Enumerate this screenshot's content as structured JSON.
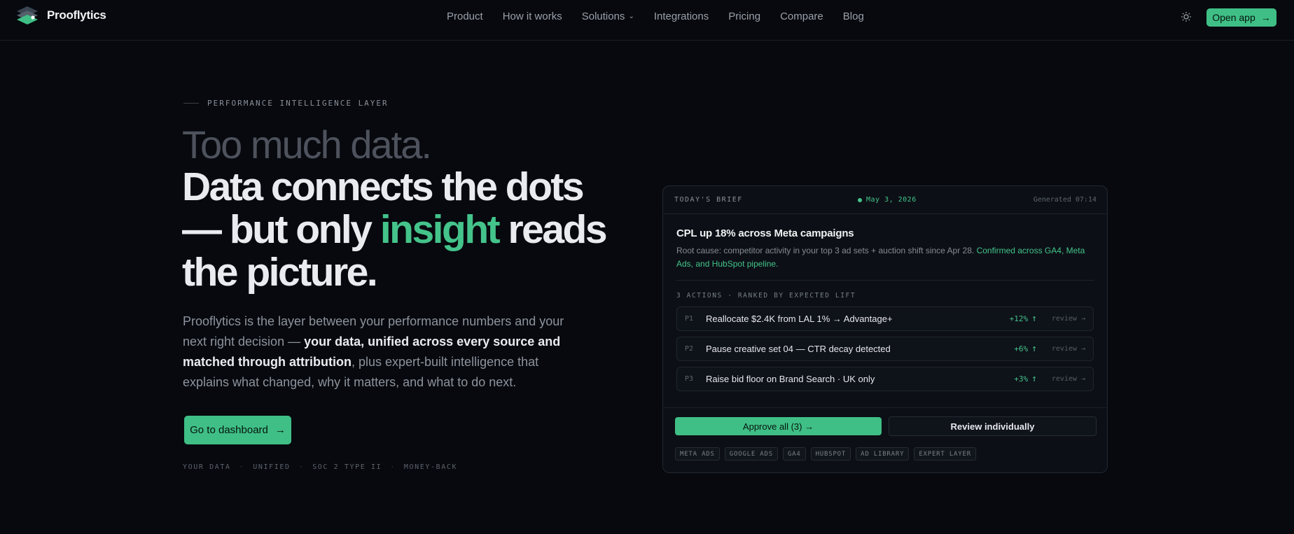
{
  "brand": {
    "name": "Prooflytics"
  },
  "nav": {
    "links": [
      "Product",
      "How it works",
      "Solutions",
      "Integrations",
      "Pricing",
      "Compare",
      "Blog"
    ],
    "open_app": "Open app"
  },
  "hero": {
    "eyebrow": "PERFORMANCE INTELLIGENCE LAYER",
    "headline_muted": "Too much data.",
    "headline_1": "Data connects the dots",
    "headline_2a": "— but only ",
    "headline_accent": "insight",
    "headline_2b": " reads",
    "headline_3": "the picture.",
    "lede_1": "Prooflytics is the layer between your performance numbers and your next right decision — ",
    "lede_bold": "your data, unified across every source and matched through attribution",
    "lede_2": ", plus expert-built intelligence that explains what changed, why it matters, and what to do next.",
    "cta": "Go to dashboard",
    "trust": [
      "YOUR DATA",
      "UNIFIED",
      "SOC 2 TYPE II",
      "MONEY-BACK"
    ]
  },
  "brief": {
    "label": "TODAY'S BRIEF",
    "date": "May 3, 2026",
    "generated": "Generated 07:14",
    "title": "CPL up 18% across Meta campaigns",
    "desc_1": "Root cause: competitor activity in your top 3 ad sets + auction shift since Apr 28. ",
    "desc_green": "Confirmed across GA4, Meta Ads, and HubSpot pipeline.",
    "actions_label": "3 ACTIONS · RANKED BY EXPECTED LIFT",
    "actions": [
      {
        "p": "P1",
        "text": "Reallocate $2.4K from LAL 1% → Advantage+",
        "lift": "+12%",
        "review": "review →"
      },
      {
        "p": "P2",
        "text": "Pause creative set 04 — CTR decay detected",
        "lift": "+6%",
        "review": "review →"
      },
      {
        "p": "P3",
        "text": "Raise bid floor on Brand Search · UK only",
        "lift": "+3%",
        "review": "review →"
      }
    ],
    "approve": "Approve all (3) →",
    "review_individually": "Review individually",
    "sources": [
      "META ADS",
      "GOOGLE ADS",
      "GA4",
      "HUBSPOT",
      "AD LIBRARY",
      "EXPERT LAYER"
    ]
  },
  "colors": {
    "accent": "#44c38a",
    "background": "#07090e"
  }
}
